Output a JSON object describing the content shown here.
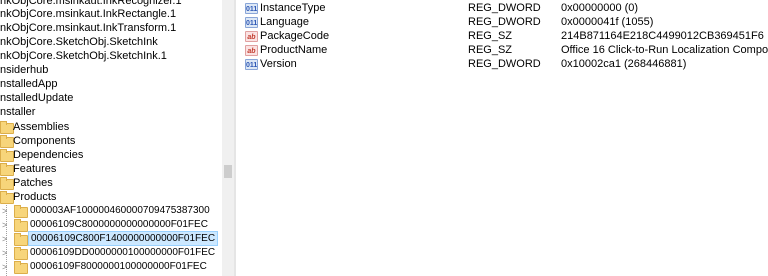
{
  "tree": {
    "items": [
      {
        "label": "nkObjCore.msinkaut.InkRecognizer.1"
      },
      {
        "label": "nkObjCore.msinkaut.InkRectangle.1"
      },
      {
        "label": "nkObjCore.msinkaut.InkTransform.1"
      },
      {
        "label": "nkObjCore.SketchObj.SketchInk"
      },
      {
        "label": "nkObjCore.SketchObj.SketchInk.1"
      },
      {
        "label": "nsiderhub"
      },
      {
        "label": "nstalledApp"
      },
      {
        "label": "nstalledUpdate"
      },
      {
        "label": "nstaller"
      },
      {
        "label": "Assemblies"
      },
      {
        "label": "Components"
      },
      {
        "label": "Dependencies"
      },
      {
        "label": "Features"
      },
      {
        "label": "Patches"
      },
      {
        "label": "Products"
      },
      {
        "label": "000003AF100000460000709475387300"
      },
      {
        "label": "00006109C8000000000000000F01FEC"
      },
      {
        "label": "00006109C800F1400000000000F01FEC"
      },
      {
        "label": "00006109DD0000000100000000F01FEC"
      },
      {
        "label": "00006109F8000000100000000F01FEC"
      }
    ]
  },
  "values": {
    "rows": [
      {
        "name": "InstanceType",
        "type": "REG_DWORD",
        "data": "0x00000000 (0)",
        "icon": "dword-icon",
        "icon_text": "011\n110"
      },
      {
        "name": "Language",
        "type": "REG_DWORD",
        "data": "0x0000041f (1055)",
        "icon": "dword-icon",
        "icon_text": "011\n110"
      },
      {
        "name": "PackageCode",
        "type": "REG_SZ",
        "data": "214B871164E218C4499012CB369451F6",
        "icon": "string-icon",
        "icon_text": "ab"
      },
      {
        "name": "ProductName",
        "type": "REG_SZ",
        "data": "Office 16 Click-to-Run Localization Component",
        "icon": "string-icon",
        "icon_text": "ab"
      },
      {
        "name": "Version",
        "type": "REG_DWORD",
        "data": "0x10002ca1 (268446881)",
        "icon": "dword-icon",
        "icon_text": "011\n110"
      }
    ]
  }
}
